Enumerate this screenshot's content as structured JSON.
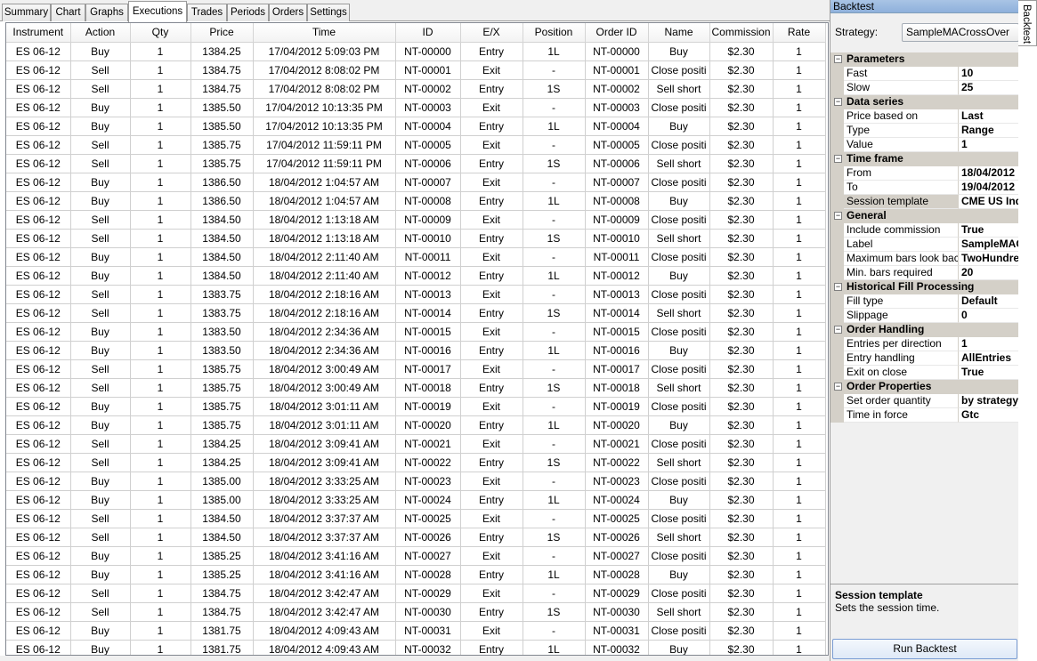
{
  "tabs": [
    "Summary",
    "Chart",
    "Graphs",
    "Executions",
    "Trades",
    "Periods",
    "Orders",
    "Settings"
  ],
  "active_tab": "Executions",
  "columns": [
    "Instrument",
    "Action",
    "Qty",
    "Price",
    "Time",
    "ID",
    "E/X",
    "Position",
    "Order ID",
    "Name",
    "Commission",
    "Rate"
  ],
  "rows": [
    [
      "ES 06-12",
      "Buy",
      "1",
      "1384.25",
      "17/04/2012 5:09:03 PM",
      "NT-00000",
      "Entry",
      "1L",
      "NT-00000",
      "Buy",
      "$2.30",
      "1"
    ],
    [
      "ES 06-12",
      "Sell",
      "1",
      "1384.75",
      "17/04/2012 8:08:02 PM",
      "NT-00001",
      "Exit",
      "-",
      "NT-00001",
      "Close positi",
      "$2.30",
      "1"
    ],
    [
      "ES 06-12",
      "Sell",
      "1",
      "1384.75",
      "17/04/2012 8:08:02 PM",
      "NT-00002",
      "Entry",
      "1S",
      "NT-00002",
      "Sell short",
      "$2.30",
      "1"
    ],
    [
      "ES 06-12",
      "Buy",
      "1",
      "1385.50",
      "17/04/2012 10:13:35 PM",
      "NT-00003",
      "Exit",
      "-",
      "NT-00003",
      "Close positi",
      "$2.30",
      "1"
    ],
    [
      "ES 06-12",
      "Buy",
      "1",
      "1385.50",
      "17/04/2012 10:13:35 PM",
      "NT-00004",
      "Entry",
      "1L",
      "NT-00004",
      "Buy",
      "$2.30",
      "1"
    ],
    [
      "ES 06-12",
      "Sell",
      "1",
      "1385.75",
      "17/04/2012 11:59:11 PM",
      "NT-00005",
      "Exit",
      "-",
      "NT-00005",
      "Close positi",
      "$2.30",
      "1"
    ],
    [
      "ES 06-12",
      "Sell",
      "1",
      "1385.75",
      "17/04/2012 11:59:11 PM",
      "NT-00006",
      "Entry",
      "1S",
      "NT-00006",
      "Sell short",
      "$2.30",
      "1"
    ],
    [
      "ES 06-12",
      "Buy",
      "1",
      "1386.50",
      "18/04/2012 1:04:57 AM",
      "NT-00007",
      "Exit",
      "-",
      "NT-00007",
      "Close positi",
      "$2.30",
      "1"
    ],
    [
      "ES 06-12",
      "Buy",
      "1",
      "1386.50",
      "18/04/2012 1:04:57 AM",
      "NT-00008",
      "Entry",
      "1L",
      "NT-00008",
      "Buy",
      "$2.30",
      "1"
    ],
    [
      "ES 06-12",
      "Sell",
      "1",
      "1384.50",
      "18/04/2012 1:13:18 AM",
      "NT-00009",
      "Exit",
      "-",
      "NT-00009",
      "Close positi",
      "$2.30",
      "1"
    ],
    [
      "ES 06-12",
      "Sell",
      "1",
      "1384.50",
      "18/04/2012 1:13:18 AM",
      "NT-00010",
      "Entry",
      "1S",
      "NT-00010",
      "Sell short",
      "$2.30",
      "1"
    ],
    [
      "ES 06-12",
      "Buy",
      "1",
      "1384.50",
      "18/04/2012 2:11:40 AM",
      "NT-00011",
      "Exit",
      "-",
      "NT-00011",
      "Close positi",
      "$2.30",
      "1"
    ],
    [
      "ES 06-12",
      "Buy",
      "1",
      "1384.50",
      "18/04/2012 2:11:40 AM",
      "NT-00012",
      "Entry",
      "1L",
      "NT-00012",
      "Buy",
      "$2.30",
      "1"
    ],
    [
      "ES 06-12",
      "Sell",
      "1",
      "1383.75",
      "18/04/2012 2:18:16 AM",
      "NT-00013",
      "Exit",
      "-",
      "NT-00013",
      "Close positi",
      "$2.30",
      "1"
    ],
    [
      "ES 06-12",
      "Sell",
      "1",
      "1383.75",
      "18/04/2012 2:18:16 AM",
      "NT-00014",
      "Entry",
      "1S",
      "NT-00014",
      "Sell short",
      "$2.30",
      "1"
    ],
    [
      "ES 06-12",
      "Buy",
      "1",
      "1383.50",
      "18/04/2012 2:34:36 AM",
      "NT-00015",
      "Exit",
      "-",
      "NT-00015",
      "Close positi",
      "$2.30",
      "1"
    ],
    [
      "ES 06-12",
      "Buy",
      "1",
      "1383.50",
      "18/04/2012 2:34:36 AM",
      "NT-00016",
      "Entry",
      "1L",
      "NT-00016",
      "Buy",
      "$2.30",
      "1"
    ],
    [
      "ES 06-12",
      "Sell",
      "1",
      "1385.75",
      "18/04/2012 3:00:49 AM",
      "NT-00017",
      "Exit",
      "-",
      "NT-00017",
      "Close positi",
      "$2.30",
      "1"
    ],
    [
      "ES 06-12",
      "Sell",
      "1",
      "1385.75",
      "18/04/2012 3:00:49 AM",
      "NT-00018",
      "Entry",
      "1S",
      "NT-00018",
      "Sell short",
      "$2.30",
      "1"
    ],
    [
      "ES 06-12",
      "Buy",
      "1",
      "1385.75",
      "18/04/2012 3:01:11 AM",
      "NT-00019",
      "Exit",
      "-",
      "NT-00019",
      "Close positi",
      "$2.30",
      "1"
    ],
    [
      "ES 06-12",
      "Buy",
      "1",
      "1385.75",
      "18/04/2012 3:01:11 AM",
      "NT-00020",
      "Entry",
      "1L",
      "NT-00020",
      "Buy",
      "$2.30",
      "1"
    ],
    [
      "ES 06-12",
      "Sell",
      "1",
      "1384.25",
      "18/04/2012 3:09:41 AM",
      "NT-00021",
      "Exit",
      "-",
      "NT-00021",
      "Close positi",
      "$2.30",
      "1"
    ],
    [
      "ES 06-12",
      "Sell",
      "1",
      "1384.25",
      "18/04/2012 3:09:41 AM",
      "NT-00022",
      "Entry",
      "1S",
      "NT-00022",
      "Sell short",
      "$2.30",
      "1"
    ],
    [
      "ES 06-12",
      "Buy",
      "1",
      "1385.00",
      "18/04/2012 3:33:25 AM",
      "NT-00023",
      "Exit",
      "-",
      "NT-00023",
      "Close positi",
      "$2.30",
      "1"
    ],
    [
      "ES 06-12",
      "Buy",
      "1",
      "1385.00",
      "18/04/2012 3:33:25 AM",
      "NT-00024",
      "Entry",
      "1L",
      "NT-00024",
      "Buy",
      "$2.30",
      "1"
    ],
    [
      "ES 06-12",
      "Sell",
      "1",
      "1384.50",
      "18/04/2012 3:37:37 AM",
      "NT-00025",
      "Exit",
      "-",
      "NT-00025",
      "Close positi",
      "$2.30",
      "1"
    ],
    [
      "ES 06-12",
      "Sell",
      "1",
      "1384.50",
      "18/04/2012 3:37:37 AM",
      "NT-00026",
      "Entry",
      "1S",
      "NT-00026",
      "Sell short",
      "$2.30",
      "1"
    ],
    [
      "ES 06-12",
      "Buy",
      "1",
      "1385.25",
      "18/04/2012 3:41:16 AM",
      "NT-00027",
      "Exit",
      "-",
      "NT-00027",
      "Close positi",
      "$2.30",
      "1"
    ],
    [
      "ES 06-12",
      "Buy",
      "1",
      "1385.25",
      "18/04/2012 3:41:16 AM",
      "NT-00028",
      "Entry",
      "1L",
      "NT-00028",
      "Buy",
      "$2.30",
      "1"
    ],
    [
      "ES 06-12",
      "Sell",
      "1",
      "1384.75",
      "18/04/2012 3:42:47 AM",
      "NT-00029",
      "Exit",
      "-",
      "NT-00029",
      "Close positi",
      "$2.30",
      "1"
    ],
    [
      "ES 06-12",
      "Sell",
      "1",
      "1384.75",
      "18/04/2012 3:42:47 AM",
      "NT-00030",
      "Entry",
      "1S",
      "NT-00030",
      "Sell short",
      "$2.30",
      "1"
    ],
    [
      "ES 06-12",
      "Buy",
      "1",
      "1381.75",
      "18/04/2012 4:09:43 AM",
      "NT-00031",
      "Exit",
      "-",
      "NT-00031",
      "Close positi",
      "$2.30",
      "1"
    ],
    [
      "ES 06-12",
      "Buy",
      "1",
      "1381.75",
      "18/04/2012 4:09:43 AM",
      "NT-00032",
      "Entry",
      "1L",
      "NT-00032",
      "Buy",
      "$2.30",
      "1"
    ]
  ],
  "panel": {
    "title": "Backtest",
    "strategy_label": "Strategy:",
    "strategy_value": "SampleMACrossOver",
    "vertical_tab": "Backtest",
    "categories": [
      {
        "name": "Parameters",
        "props": [
          [
            "Fast",
            "10"
          ],
          [
            "Slow",
            "25"
          ]
        ]
      },
      {
        "name": "Data series",
        "props": [
          [
            "Price based on",
            "Last"
          ],
          [
            "Type",
            "Range"
          ],
          [
            "Value",
            "1"
          ]
        ]
      },
      {
        "name": "Time frame",
        "props": [
          [
            "From",
            "18/04/2012"
          ],
          [
            "To",
            "19/04/2012"
          ],
          [
            "Session template",
            "CME US Ind"
          ]
        ]
      },
      {
        "name": "General",
        "props": [
          [
            "Include commission",
            "True"
          ],
          [
            "Label",
            "SampleMAC"
          ],
          [
            "Maximum bars look back",
            "TwoHundre"
          ],
          [
            "Min. bars required",
            "20"
          ]
        ]
      },
      {
        "name": "Historical Fill Processing",
        "props": [
          [
            "Fill type",
            "Default"
          ],
          [
            "Slippage",
            "0"
          ]
        ]
      },
      {
        "name": "Order Handling",
        "props": [
          [
            "Entries per direction",
            "1"
          ],
          [
            "Entry handling",
            "AllEntries"
          ],
          [
            "Exit on close",
            "True"
          ]
        ]
      },
      {
        "name": "Order Properties",
        "props": [
          [
            "Set order quantity",
            "by strategy"
          ],
          [
            "Time in force",
            "Gtc"
          ]
        ]
      }
    ],
    "selected_property": "Session template",
    "help_title": "Session template",
    "help_text": "Sets the session time.",
    "run_button": "Run Backtest"
  },
  "colors": {
    "title_bar": "#a9c4e5",
    "category_bg": "#d4d0c8",
    "grid_line": "#d0d0d0"
  }
}
